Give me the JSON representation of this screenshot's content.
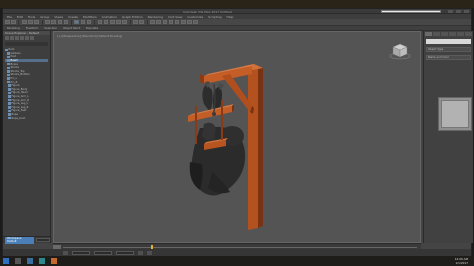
{
  "window": {
    "title": "Autodesk 3ds Max 2017   Untitled"
  },
  "menus": [
    "File",
    "Edit",
    "Tools",
    "Group",
    "Views",
    "Create",
    "Modifiers",
    "Animation",
    "Graph Editors",
    "Rendering",
    "Civil View",
    "Customize",
    "Scripting",
    "Help"
  ],
  "ribbon_tabs": [
    "Modeling",
    "Freeform",
    "Selection",
    "Object Paint",
    "Populate"
  ],
  "scene_explorer": {
    "header": "Scene Explorer - Default",
    "filter_placeholder": "",
    "tree": [
      "Root",
      "Gallows",
      "Post",
      "Beam",
      "Brace",
      "Stocks",
      "Stocks_Top",
      "Stocks_Bottom",
      "Pin_L",
      "Pin_R",
      "Figure",
      "Figure_Body",
      "Figure_Head",
      "Figure_Arm_L",
      "Figure_Arm_R",
      "Figure_Leg_L",
      "Figure_Leg_R",
      "Figure_Feet",
      "Rope",
      "Rope_Knot"
    ],
    "selected_index": 3,
    "layer_badge": "Workspace: Default"
  },
  "viewport": {
    "label": "[+] [Perspective] [Standard] [Default Shading]"
  },
  "colors": {
    "wood": "#b4521f",
    "figure": "#2d2d2d",
    "viewport_bg": "#545454",
    "selection": "#4a7fb8"
  },
  "command_panel": {
    "search_placeholder": "",
    "rollouts": [
      "Object Type",
      "Name and Color"
    ]
  },
  "taskbar": {
    "time": "12:00 AM",
    "date": "1/1/2017"
  }
}
